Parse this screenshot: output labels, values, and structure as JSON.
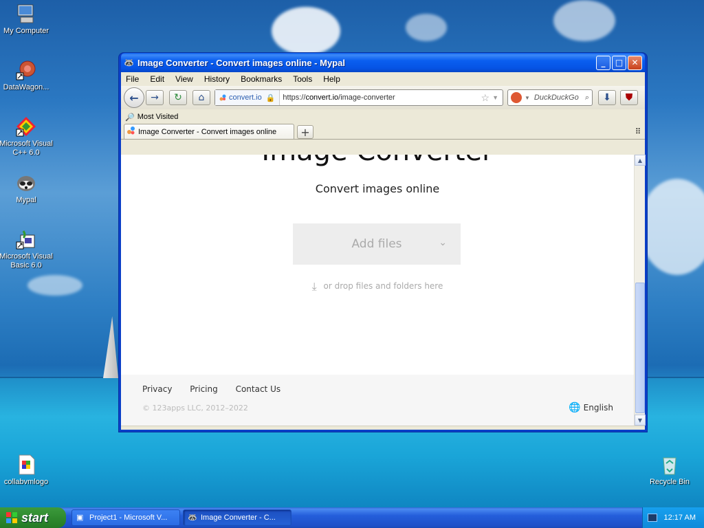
{
  "desktop": {
    "icons": [
      {
        "label": "My Computer",
        "icon": "computer-icon"
      },
      {
        "label": "DataWagon...",
        "icon": "datawagon-icon"
      },
      {
        "label": "Microsoft Visual C++ 6.0",
        "icon": "visual-cpp-icon"
      },
      {
        "label": "Mypal",
        "icon": "mypal-icon"
      },
      {
        "label": "Microsoft Visual Basic 6.0",
        "icon": "visual-basic-icon"
      },
      {
        "label": "collabvmlogo",
        "icon": "image-file-icon"
      },
      {
        "label": "Recycle Bin",
        "icon": "recycle-bin-icon"
      }
    ]
  },
  "window": {
    "title": "Image Converter - Convert images online - Mypal",
    "menu": [
      "File",
      "Edit",
      "View",
      "History",
      "Bookmarks",
      "Tools",
      "Help"
    ],
    "site_identity": "convert.io",
    "url_prefix": "https://",
    "url_domain": "convert.io",
    "url_path": "/image-converter",
    "search_placeholder": "DuckDuckGo",
    "bookmark_folder": "Most Visited",
    "tab_title": "Image Converter - Convert images online"
  },
  "page": {
    "title": "Image Converter",
    "subtitle": "Convert images online",
    "add_files_label": "Add files",
    "drop_hint": "or drop files and folders here",
    "footer_links": [
      "Privacy",
      "Pricing",
      "Contact Us"
    ],
    "copyright": "© 123apps LLC, 2012–2022",
    "language": "English"
  },
  "taskbar": {
    "start_label": "start",
    "tasks": [
      "Project1 - Microsoft V...",
      "Image Converter - C..."
    ],
    "clock": "12:17 AM"
  },
  "colors": {
    "titlebar_blue": "#0a5ef0",
    "start_green": "#2f8a2f",
    "taskbar_blue": "#245edb"
  }
}
